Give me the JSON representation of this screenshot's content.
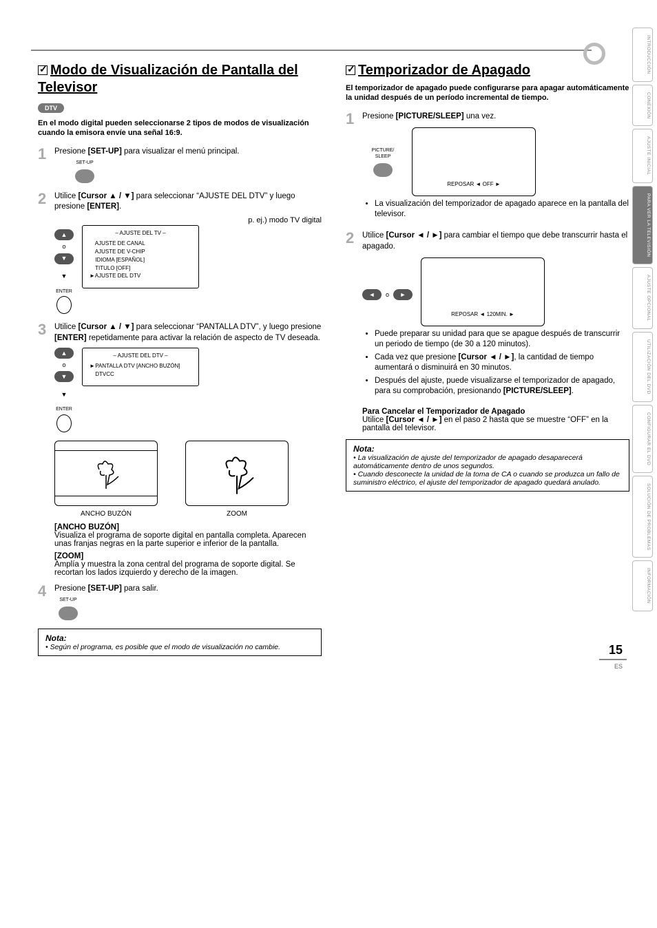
{
  "page": {
    "number": "15",
    "lang": "ES"
  },
  "side_tabs": [
    "INTRODUCCIÓN",
    "CONEXIÓN",
    "AJUSTE INICIAL",
    "PARA VER LA TELEVISIÓN",
    "AJUSTE OPCIONAL",
    "UTILIZACIÓN DEL DVD",
    "CONFIGURAR EL DVD",
    "SOLUCIÓN DE PROBLEMAS",
    "INFORMACIÓN"
  ],
  "side_tabs_active_index": 3,
  "left": {
    "title": "Modo de Visualización de Pantalla del Televisor",
    "badge": "DTV",
    "intro": "En el modo digital pueden seleccionarse 2 tipos de modos de visualización cuando la emisora envíe una señal 16:9.",
    "step1": {
      "text_before": "Presione ",
      "bold": "[SET-UP]",
      "text_after": " para visualizar el menú principal.",
      "btn_label": "SET-UP"
    },
    "step2": {
      "text_a": "Utilice ",
      "bold_a": "[Cursor ▲ / ▼]",
      "text_b": " para seleccionar “AJUSTE DEL DTV” y luego presione ",
      "bold_b": "[ENTER]",
      "text_c": ".",
      "eg_label": "p. ej.) modo TV digital",
      "osd_title": "–   AJUSTE DEL TV   –",
      "osd_lines": [
        "AJUSTE DE CANAL",
        "AJUSTE DE V-CHIP",
        "IDIOMA  [ESPAÑOL]",
        "TITULO  [OFF]",
        "AJUSTE DEL DTV"
      ],
      "osd_cursor_index": 4,
      "enter_label": "ENTER"
    },
    "step3": {
      "text_a": "Utilice ",
      "bold_a": "[Cursor ▲ / ▼]",
      "text_b": " para seleccionar “PANTALLA DTV”, y luego presione ",
      "bold_b": "[ENTER]",
      "text_c": " repetidamente para activar la relación de aspecto de TV deseada.",
      "osd_title": "–   AJUSTE DEL DTV   –",
      "osd_lines": [
        "PANTALLA DTV [ANCHO BUZÓN]",
        "DTVCC"
      ],
      "osd_cursor_index": 0,
      "enter_label": "ENTER",
      "thumb_a_label": "ANCHO BUZÓN",
      "thumb_b_label": "ZOOM"
    },
    "zoom_modes": {
      "ancho_head": "[ANCHO BUZÓN]",
      "ancho_body": "Visualiza el programa de soporte digital en pantalla completa. Aparecen unas franjas negras en la parte superior e inferior de la pantalla.",
      "zoom_head": "[ZOOM]",
      "zoom_body": "Amplía y muestra la zona central del programa de soporte digital. Se recortan los lados izquierdo y derecho de la imagen."
    },
    "step4": {
      "text_before": "Presione ",
      "bold": "[SET-UP]",
      "text_after": " para salir.",
      "btn_label": "SET-UP"
    },
    "note": {
      "head": "Nota:",
      "body": "Según el programa, es posible que el modo de visualización no cambie."
    }
  },
  "right": {
    "title": "Temporizador de Apagado",
    "intro": "El temporizador de apagado puede configurarse para apagar automáticamente la unidad después de un período incremental de tiempo.",
    "step1": {
      "text_before": "Presione ",
      "bold": "[PICTURE/SLEEP]",
      "text_after": " una vez.",
      "btn_label": "PICTURE/\nSLEEP",
      "osd_line": "REPOSAR  ◄  OFF  ►",
      "bullet": "La visualización del temporizador de apagado aparece en la pantalla del televisor."
    },
    "step2": {
      "text_a": "Utilice ",
      "bold_a": "[Cursor ◄ / ►]",
      "text_b": " para cambiar el tiempo que debe transcurrir hasta el apagado.",
      "o_sep": "o",
      "osd_line": "REPOSAR  ◄ 120MIN. ►",
      "bullets": [
        "Puede preparar su unidad para que se apague después de transcurrir un periodo de tiempo (de 30 a 120 minutos).",
        "Cada vez que presione [Cursor ◄ / ►], la cantidad de tiempo aumentará o disminuirá en 30 minutos.",
        "Después del ajuste, puede visualizarse el temporizador de apagado, para su comprobación, presionando [PICTURE/SLEEP]."
      ]
    },
    "cancel": {
      "head": "Para Cancelar el Temporizador de Apagado",
      "text_a": "Utilice ",
      "bold_a": "[Cursor ◄ / ►]",
      "text_b": " en el paso 2 hasta que se muestre “OFF” en la pantalla del televisor."
    },
    "note": {
      "head": "Nota:",
      "items": [
        "La visualización de ajuste del temporizador de apagado desaparecerá automáticamente dentro de unos segundos.",
        "Cuando desconecte la unidad de la toma de CA o cuando se produzca un fallo de suministro eléctrico, el ajuste del temporizador de apagado quedará anulado."
      ]
    }
  }
}
